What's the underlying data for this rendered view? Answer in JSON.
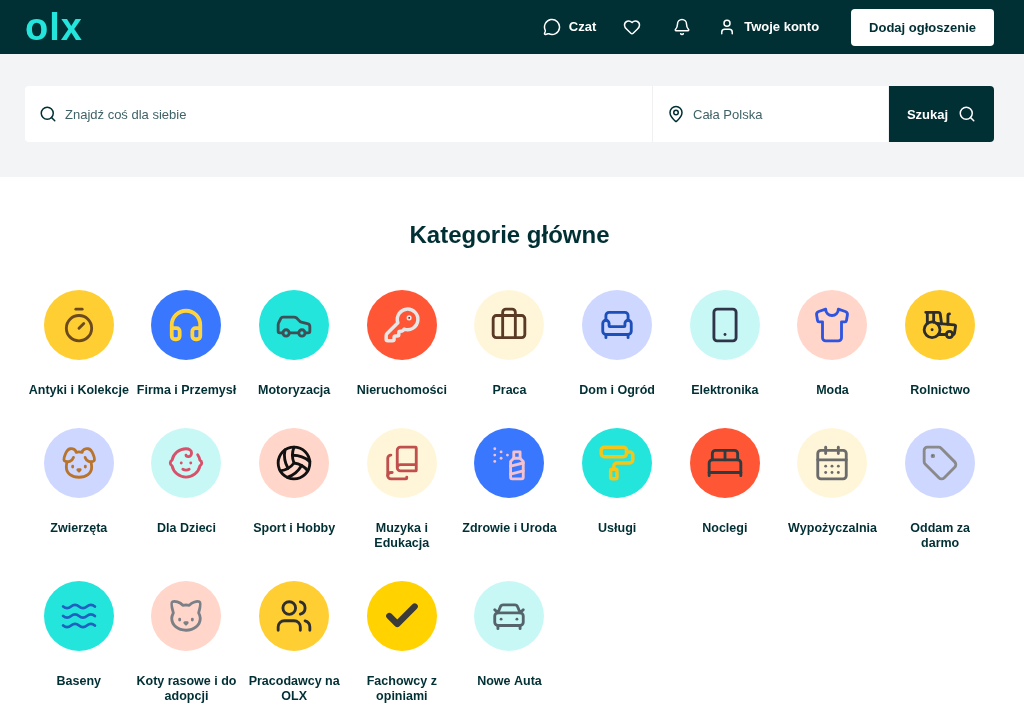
{
  "header": {
    "logo": "olx",
    "chat_label": "Czat",
    "account_label": "Twoje konto",
    "post_button": "Dodaj ogłoszenie"
  },
  "search": {
    "query_placeholder": "Znajdź coś dla siebie",
    "location_placeholder": "Cała Polska",
    "button": "Szukaj"
  },
  "categories_section": {
    "title": "Kategorie główne",
    "categories": [
      {
        "label": "Antyki i Kolekcje",
        "color": "#ffce32"
      },
      {
        "label": "Firma i Przemysł",
        "color": "#3a77ff"
      },
      {
        "label": "Motoryzacja",
        "color": "#23e5db"
      },
      {
        "label": "Nieruchomości",
        "color": "#ff5636"
      },
      {
        "label": "Praca",
        "color": "#fff6d9"
      },
      {
        "label": "Dom i Ogród",
        "color": "#ced7ff"
      },
      {
        "label": "Elektronika",
        "color": "#c8f8f6"
      },
      {
        "label": "Moda",
        "color": "#ffd6c9"
      },
      {
        "label": "Rolnictwo",
        "color": "#ffce32"
      },
      {
        "label": "Zwierzęta",
        "color": "#ced7ff"
      },
      {
        "label": "Dla Dzieci",
        "color": "#c8f8f6"
      },
      {
        "label": "Sport i Hobby",
        "color": "#ffd6c9"
      },
      {
        "label": "Muzyka i Edukacja",
        "color": "#fff6d9"
      },
      {
        "label": "Zdrowie i Uroda",
        "color": "#3a77ff"
      },
      {
        "label": "Usługi",
        "color": "#23e5db"
      },
      {
        "label": "Noclegi",
        "color": "#ff5636"
      },
      {
        "label": "Wypożyczalnia",
        "color": "#fff6d9"
      },
      {
        "label": "Oddam za darmo",
        "color": "#ced7ff"
      },
      {
        "label": "Baseny",
        "color": "#23e5db"
      },
      {
        "label": "Koty rasowe i do adopcji",
        "color": "#ffd6c9"
      },
      {
        "label": "Pracodawcy na OLX",
        "color": "#ffce32"
      },
      {
        "label": "Fachowcy z opiniami",
        "color": "#ffd200"
      },
      {
        "label": "Nowe Auta",
        "color": "#c8f8f6"
      }
    ]
  }
}
